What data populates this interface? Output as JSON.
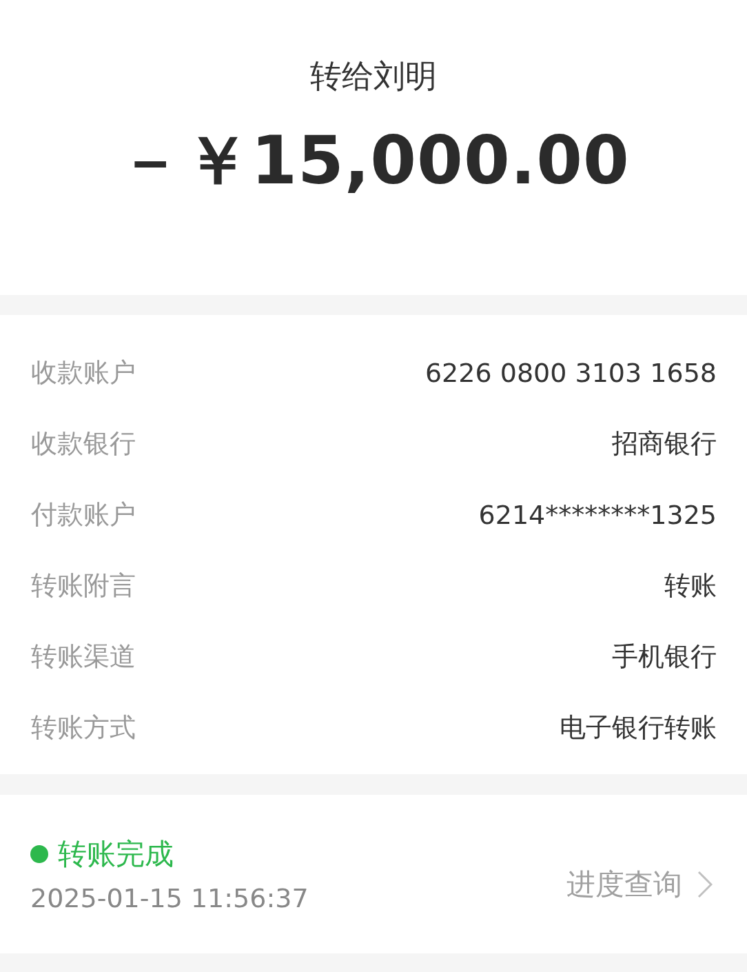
{
  "header": {
    "title": "转给刘明",
    "amount": "－￥15,000.00"
  },
  "details": [
    {
      "label": "收款账户",
      "value": "6226 0800 3103 1658"
    },
    {
      "label": "收款银行",
      "value": "招商银行"
    },
    {
      "label": "付款账户",
      "value": "6214********1325"
    },
    {
      "label": "转账附言",
      "value": "转账"
    },
    {
      "label": "转账渠道",
      "value": "手机银行"
    },
    {
      "label": "转账方式",
      "value": "电子银行转账"
    }
  ],
  "status": {
    "kind": "success",
    "label": "转账完成",
    "time": "2025-01-15 11:56:37",
    "link": "进度查询"
  }
}
